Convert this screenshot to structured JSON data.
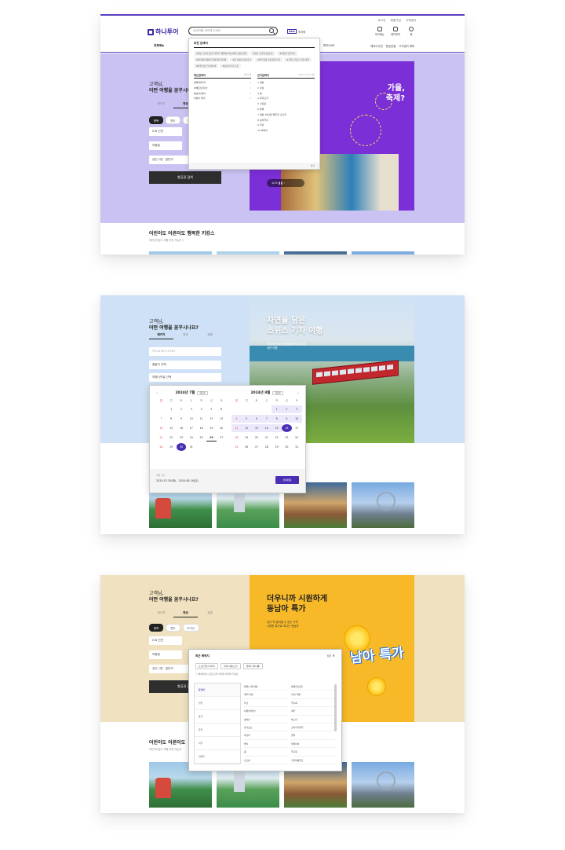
{
  "brand": {
    "accent": "#5a3fbf",
    "dark_button": "#2e2e2e",
    "logo_text": "하나투어"
  },
  "shot1": {
    "toplinks": [
      "로그인",
      "회원가입",
      "고객센터"
    ],
    "search_placeholder": "검색어를 입력해 주세요",
    "hdr_chip_tag": "NEW",
    "hdr_chip_label": "투어위",
    "hdr_icons": [
      {
        "name": "user-icon",
        "label": "마이메뉴"
      },
      {
        "name": "booking-icon",
        "label": "예약내역"
      },
      {
        "name": "heart-icon",
        "label": "찜"
      }
    ],
    "nav_all": "전체메뉴",
    "nav_live": "투어LIVE",
    "nav_right": [
      "해외이주민",
      "항공호텔",
      "고객센터 해택"
    ],
    "greeting_line1": "고객님,",
    "greeting_line2": "어떤 여행을 꿈꾸시나요?",
    "tabs": [
      "패키지",
      "항공",
      "호텔"
    ],
    "pills": [
      "왕복",
      "편도",
      "다구간"
    ],
    "fields": [
      "ICN 인천",
      "여행일",
      "성인 1명 · 일반석"
    ],
    "search_button": "항공권 검색",
    "banner_title_line1": "가을,",
    "banner_title_line2": "축제?",
    "banner_pager": "1/10",
    "section_title": "어린이도 어른이도 행복한 키캉스",
    "section_sub": "어린이키캉스 여행 추천 가능지 1",
    "dropdown": {
      "header": "추천 검색어",
      "tags": [
        "#일본 오사카 맛집 투어부터 해변에 #다낭여행 호캉스까지",
        "#일본 속 유럽 홋카이도",
        "#서유럽 인기투어",
        "#발리에서 해변과 힐링까지 한번에",
        "#괌 사이판 여름 휴가",
        "#태국 방콕 신상 핫플 투어",
        "#스위스 알프스 기차 여행",
        "#유럽 감성 크로아티아",
        "#동남아 특가 모음"
      ],
      "recent_title": "최근검색어",
      "recent_action": "전체삭제",
      "recent": [
        "방콕/파타야",
        "#베트남/다낭",
        "동남아/발리",
        "#발리 투어"
      ],
      "popular_title": "인기검색어",
      "popular_meta": "2024.07.24 기준",
      "popular": [
        "1  일본",
        "2  다낭",
        "3  괌",
        "4  후쿠오카",
        "5  나트랑",
        "6  방콕",
        "7  일본 3박4일 패키지 오사카",
        "8  보라카이",
        "9  다낭",
        "10  하와이"
      ],
      "close": "닫기"
    }
  },
  "shot2": {
    "greeting_line1": "고객님,",
    "greeting_line2": "어떤 여행을 꿈꾸시나요?",
    "tabs": [
      "패키지",
      "항공",
      "호텔"
    ],
    "fields": [
      "어디로 떠나시나요?",
      "출발지 선택",
      "여행시작일 선택"
    ],
    "banner_title_line1": "자연을 담은",
    "banner_title_line2": "스위스 기차 여행",
    "banner_sub_line1": "지도 위 눈부신 풍경을 따라 달리며,",
    "banner_sub_line2": "낭만 여행",
    "calendar": {
      "left_month": "2024년 7월",
      "right_month": "2024년 8월",
      "month_chip": "항공편",
      "dow": [
        "일",
        "월",
        "화",
        "수",
        "목",
        "금",
        "토"
      ],
      "footer_label": "여행 기간",
      "footer_value": "2024.07.30(화) - 2024.08.16(금)",
      "confirm": "선택완료",
      "left_days": [
        "",
        "1",
        "2",
        "3",
        "4",
        "5",
        "6",
        "7",
        "8",
        "9",
        "10",
        "11",
        "12",
        "13",
        "14",
        "15",
        "16",
        "17",
        "18",
        "19",
        "20",
        "21",
        "22",
        "23",
        "24",
        "25",
        "26",
        "27",
        "28",
        "29",
        "30",
        "31",
        "",
        "",
        ""
      ],
      "right_days": [
        "",
        "",
        "",
        "",
        "1",
        "2",
        "3",
        "4",
        "5",
        "6",
        "7",
        "8",
        "9",
        "10",
        "11",
        "12",
        "13",
        "14",
        "15",
        "16",
        "17",
        "18",
        "19",
        "20",
        "21",
        "22",
        "23",
        "24",
        "25",
        "26",
        "27",
        "28",
        "29",
        "30",
        "31"
      ],
      "today_label": "오늘"
    }
  },
  "shot3": {
    "greeting_line1": "고객님,",
    "greeting_line2": "어떤 여행을 꿈꾸시나요?",
    "tabs": [
      "패키지",
      "항공",
      "호텔"
    ],
    "pills": [
      "왕복",
      "편도",
      "다구간"
    ],
    "fields": [
      "ICN 인천",
      "여행일",
      "성인 1명 · 일반석"
    ],
    "search_button": "항공권 검색",
    "banner_title_line1": "더우니까 시원하게",
    "banner_title_line2": "동남아 특가",
    "banner_sub_line1": "입이 딱 벌어질 수 있는 가격",
    "banner_sub_line2": "시원한 특가로 떠나는 동남아",
    "banner_big": "남아 특가",
    "section_title": "어린이도 어른이도",
    "section_sub": "어린이키캉스 여행 추천 가능지",
    "modal": {
      "title": "최근 목적지",
      "close": "닫기",
      "chips": [
        "도쿄(인천/나리타)",
        "파리(샤를드골)",
        "방콕(수완나품)"
      ],
      "note": "해외여행시 공항 출발 지역을 확인해 주세요",
      "cats": [
        "동남아",
        "일본",
        "중국",
        "유럽",
        "미주",
        "대양주",
        "아시아"
      ],
      "cities": [
        "방콕(수완나품)",
        "방콕(돈므앙)",
        "세부(막탄)",
        "다낭(국제)",
        "다낭",
        "푸꾸옥",
        "냐짱(깜라인)",
        "세부",
        "호찌민",
        "하노이",
        "싱가포르",
        "코타키나발루",
        "마닐라",
        "클락",
        "발리",
        "치앙마이",
        "괌",
        "푸꾸옥",
        "나트랑",
        "쿠알라룸푸르"
      ]
    }
  }
}
